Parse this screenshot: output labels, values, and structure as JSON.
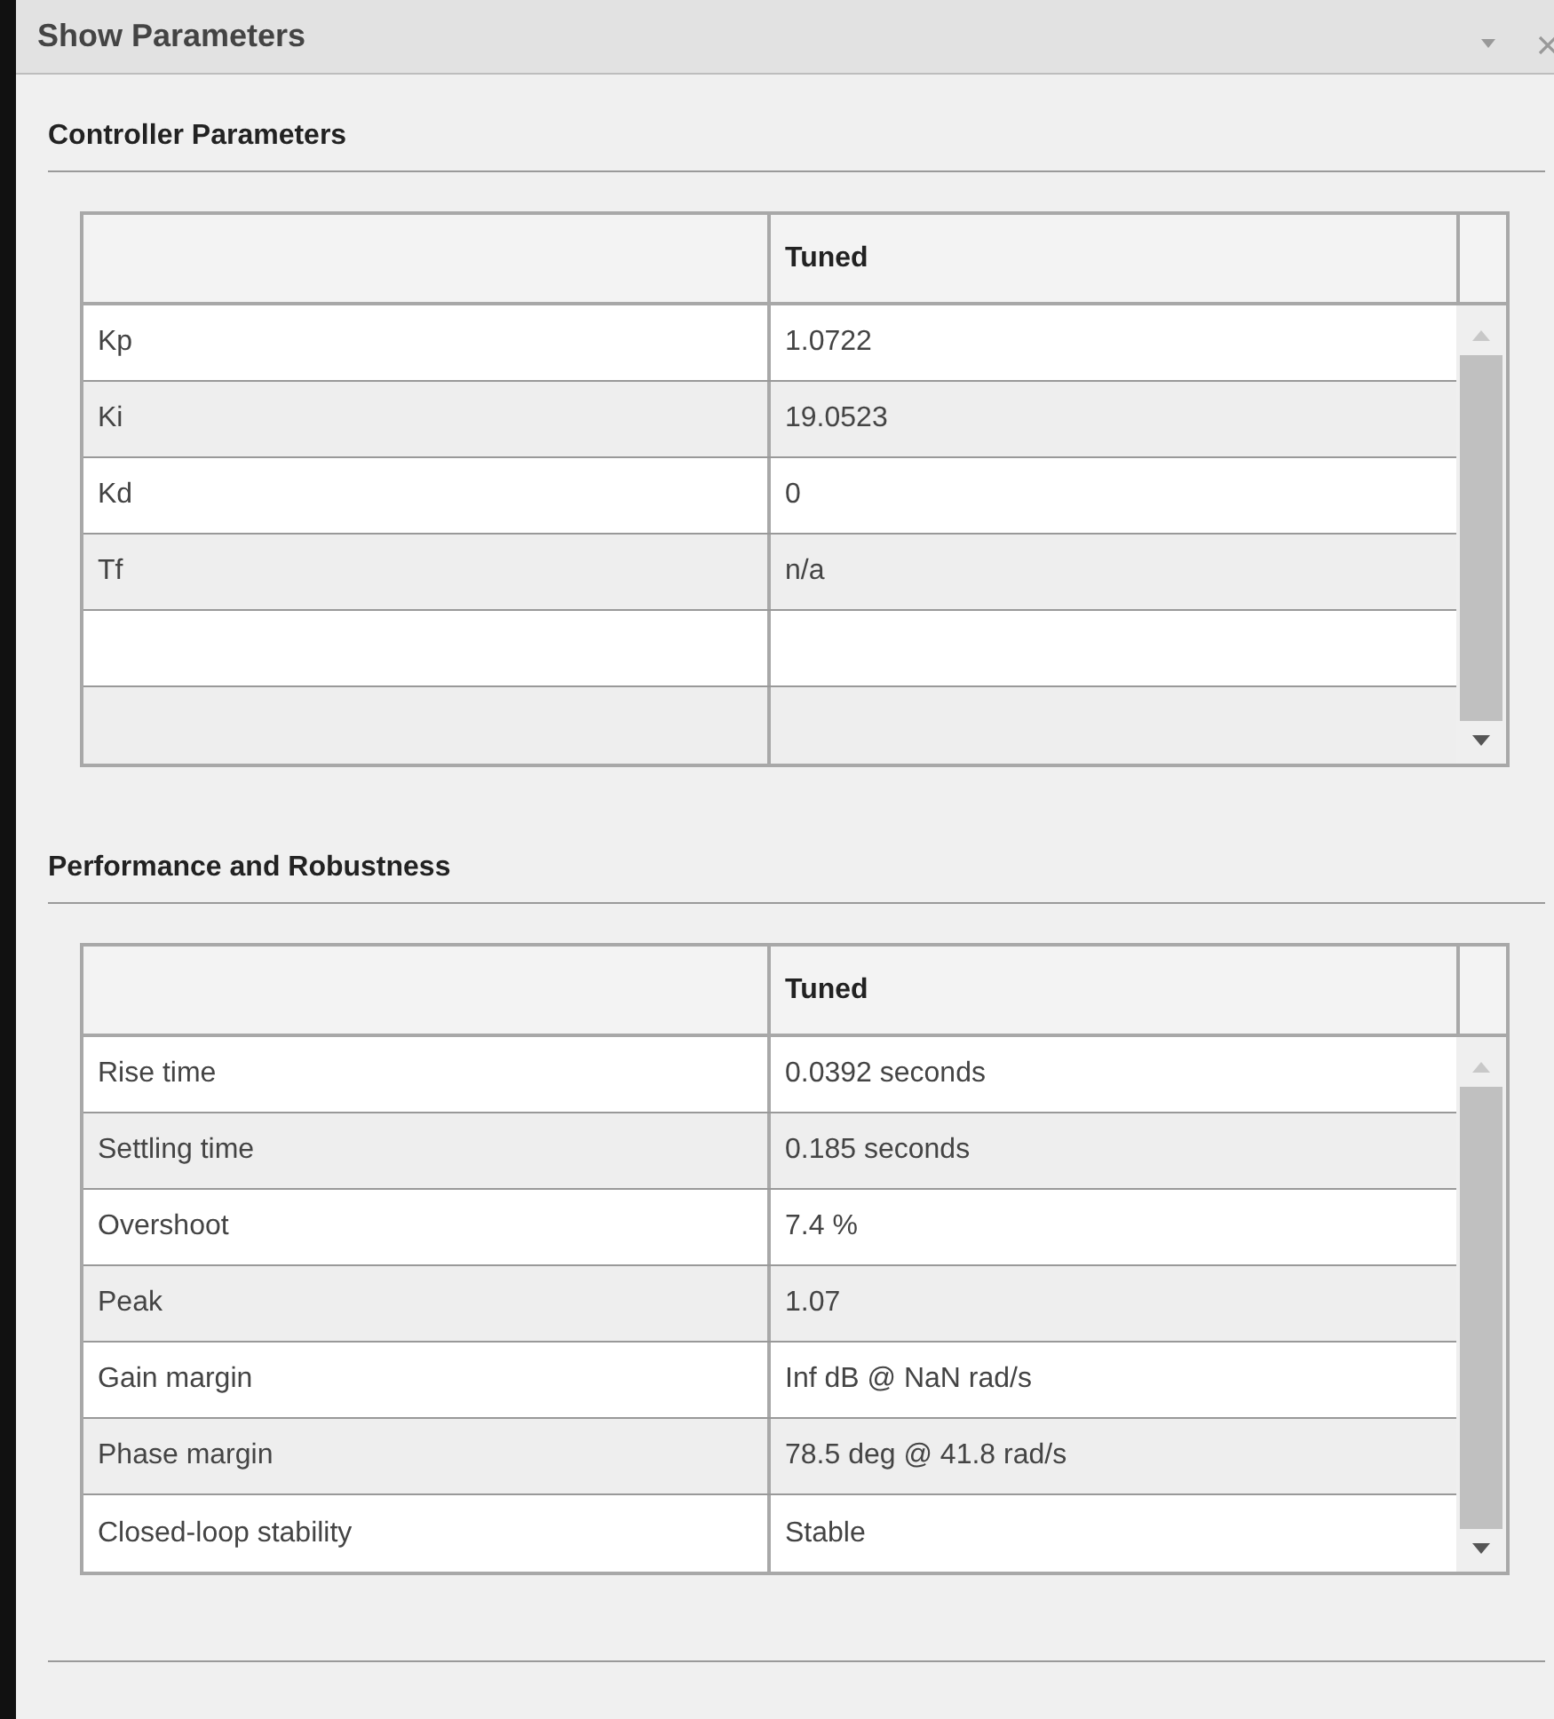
{
  "window": {
    "title": "Show Parameters"
  },
  "sections": [
    {
      "title": "Controller Parameters",
      "columns": [
        "Tuned"
      ],
      "rows": [
        {
          "label": "Kp",
          "value": "1.0722"
        },
        {
          "label": "Ki",
          "value": "19.0523"
        },
        {
          "label": "Kd",
          "value": "0"
        },
        {
          "label": "Tf",
          "value": "n/a"
        },
        {},
        {}
      ]
    },
    {
      "title": "Performance and Robustness",
      "columns": [
        "Tuned"
      ],
      "rows": [
        {
          "label": "Rise time",
          "value": "0.0392 seconds"
        },
        {
          "label": "Settling time",
          "value": "0.185 seconds"
        },
        {
          "label": "Overshoot",
          "value": "7.4 %"
        },
        {
          "label": "Peak",
          "value": "1.07"
        },
        {
          "label": "Gain margin",
          "value": "Inf dB @ NaN rad/s"
        },
        {
          "label": "Phase margin",
          "value": "78.5 deg @ 41.8 rad/s"
        },
        {
          "label": "Closed-loop stability",
          "value": "Stable"
        }
      ]
    }
  ]
}
